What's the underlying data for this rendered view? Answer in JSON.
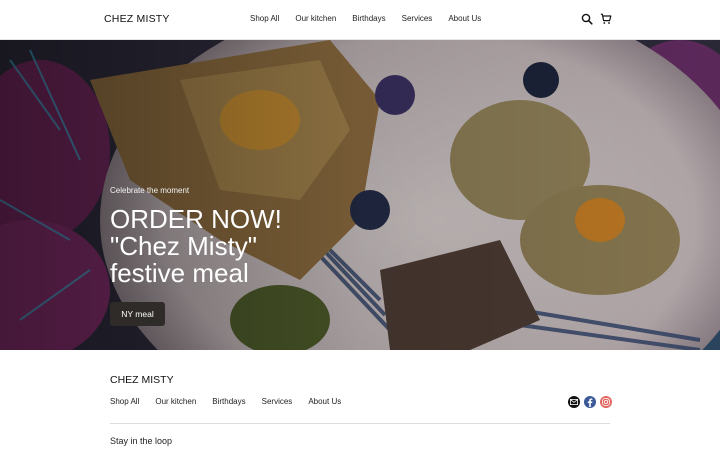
{
  "header": {
    "logo": "CHEZ MISTY",
    "nav": [
      "Shop All",
      "Our kitchen",
      "Birthdays",
      "Services",
      "About Us"
    ],
    "search_icon": "search-icon",
    "cart_icon": "cart-icon"
  },
  "hero": {
    "eyebrow": "Celebrate the moment",
    "headline": [
      "ORDER NOW!",
      "\"Chez Misty\"",
      "festive meal"
    ],
    "cta": "NY meal"
  },
  "footer": {
    "logo": "CHEZ MISTY",
    "nav": [
      "Shop All",
      "Our kitchen",
      "Birthdays",
      "Services",
      "About Us"
    ],
    "socials": [
      {
        "icon": "mail-icon",
        "color": "#111111"
      },
      {
        "icon": "facebook-icon",
        "color": "#3b5998"
      },
      {
        "icon": "instagram-icon",
        "color": "#e0665f"
      }
    ],
    "newsletter_heading": "Stay in the loop"
  },
  "colors": {
    "accent_dark": "#2e2b28",
    "text": "#111111",
    "divider": "#dddddd"
  }
}
